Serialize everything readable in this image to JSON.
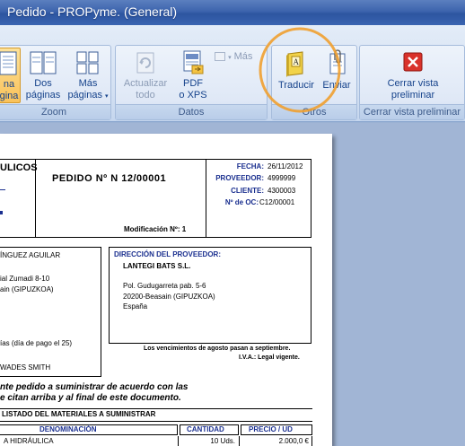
{
  "window": {
    "title": "Pedido - PROPyme. (General)"
  },
  "ribbon": {
    "zoom_group": {
      "label": "Zoom",
      "buttons": [
        {
          "line1": "na",
          "line2": "gina"
        },
        {
          "line1": "Dos",
          "line2": "páginas"
        },
        {
          "line1": "Más",
          "line2": "páginas"
        }
      ]
    },
    "datos_group": {
      "label": "Datos",
      "actualizar": {
        "line1": "Actualizar",
        "line2": "todo"
      },
      "pdf": {
        "line1": "PDF",
        "line2": "o XPS"
      },
      "mas": "Más"
    },
    "otros_group": {
      "label": "Otros",
      "traducir": "Traducir",
      "enviar": "Enviar"
    },
    "cerrar_group": {
      "label": "Cerrar vista preliminar",
      "button": {
        "line1": "Cerrar vista",
        "line2": "preliminar"
      }
    },
    "colors": {
      "highlight_circle": "#f0a030",
      "close_red": "#d9322b"
    }
  },
  "document": {
    "company_fragment": "ULICOS",
    "order_title": "PEDIDO Nº N 12/00001",
    "modification": "Modificación Nº: 1",
    "meta": [
      {
        "label": "FECHA:",
        "value": "26/11/2012"
      },
      {
        "label": "PROVEEDOR:",
        "value": "4999999"
      },
      {
        "label": "CLIENTE:",
        "value": "4300003"
      },
      {
        "label": "Nº de OC:",
        "value": "C12/00001"
      }
    ],
    "left_block": [
      "ÍNGUEZ AGUILAR",
      "ial Zumadi 8-10",
      "ain (GIPUZKOA)",
      "ías (día de pago el 25)",
      "WADES SMITH"
    ],
    "supplier": {
      "heading": "DIRECCIÓN DEL PROVEEDOR:",
      "name": "LANTEGI BATS S.L.",
      "address1": "Pol. Gudugarreta pab. 5-6",
      "address2": "20200-Beasain (GIPUZKOA)",
      "country": "España"
    },
    "notes": {
      "line1": "Los vencimientos de agosto pasan a septiembre.",
      "line2": "I.V.A.: Legal vigente."
    },
    "statement": {
      "line1": "nte pedido a suministrar de acuerdo con las",
      "line2": "e citan arriba y al final de este documento."
    },
    "materials_title": "LISTADO DEL MATERIALES A SUMINISTRAR",
    "table": {
      "headers": [
        "DENOMINACIÓN",
        "CANTIDAD",
        "PRECIO / UD"
      ],
      "rows": [
        [
          "A HIDRÁULICA",
          "10 Uds.",
          "2.000,0 €"
        ]
      ]
    }
  }
}
